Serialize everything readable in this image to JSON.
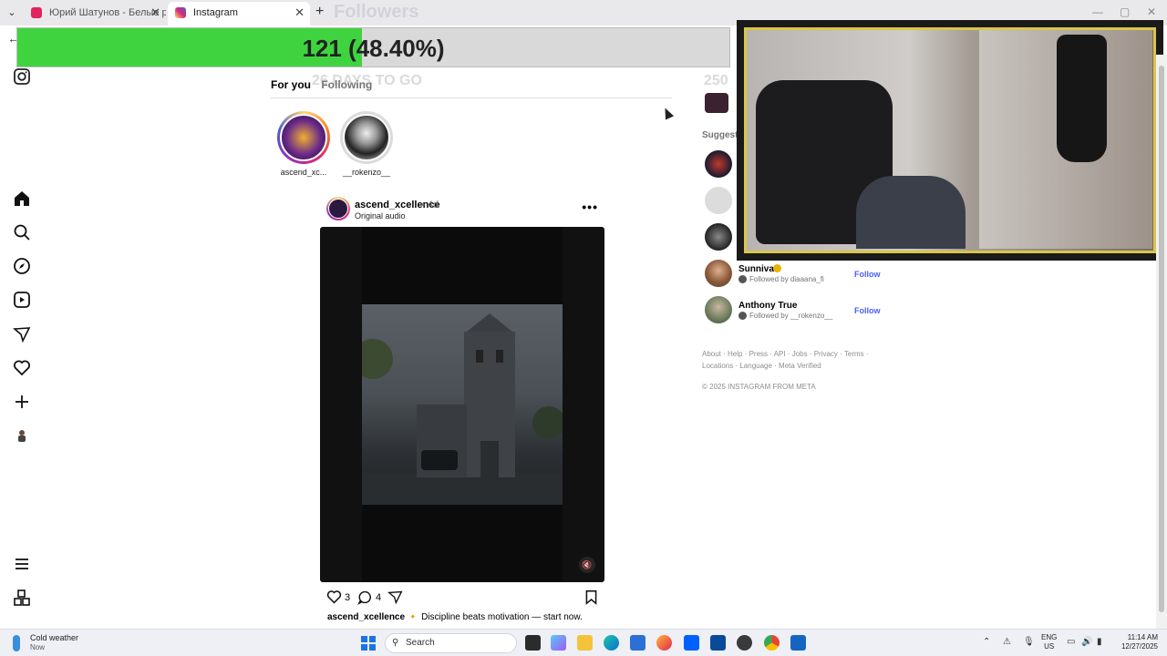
{
  "browser": {
    "tabs": [
      {
        "title": "Юрий Шатунов - Белые розы",
        "active": false,
        "favicon_color": "#e0245e"
      },
      {
        "title": "Instagram",
        "active": true,
        "favicon_color": "#d62976"
      }
    ],
    "new_tab": "+",
    "tab_close": "✕",
    "window_controls": {
      "minimize": "—",
      "maximize": "▢",
      "close": "✕"
    }
  },
  "overlay": {
    "title": "Followers",
    "progress_text": "121 (48.40%)",
    "progress_fraction": 0.484,
    "days_to_go": "26 DAYS TO GO",
    "goal": "250",
    "progress_color": "#3fd43f"
  },
  "nav": {
    "back": "←",
    "items": [
      "instagram-logo-icon",
      "home-icon",
      "search-icon",
      "explore-icon",
      "reels-icon",
      "messages-icon",
      "notifications-icon",
      "create-icon",
      "profile-icon",
      "more-menu-icon",
      "also-from-meta-icon"
    ]
  },
  "feed": {
    "tabs": [
      {
        "label": "For you",
        "active": true
      },
      {
        "label": "Following",
        "active": false
      }
    ],
    "stories": [
      {
        "name": "ascend_xc...",
        "seen": false
      },
      {
        "name": "__rokenzo__",
        "seen": true
      }
    ],
    "post": {
      "user": "ascend_xcellence",
      "time": "• 4d",
      "audio": "Original audio",
      "more": "•••",
      "likes": "3",
      "comments": "4",
      "caption_user": "ascend_xcellence",
      "caption_text": "🔸 Discipline beats motivation — start now.",
      "mute": "🔇"
    }
  },
  "sidebar": {
    "suggested_title": "Suggested",
    "suggestions": [
      {
        "name": "Sunniva",
        "verified": true,
        "followed_by": "Followed by diaaana_fi",
        "action": "Follow"
      },
      {
        "name": "Anthony True",
        "verified": false,
        "followed_by": "Followed by __rokenzo__",
        "action": "Follow"
      }
    ],
    "footer_links": "About · Help · Press · API · Jobs · Privacy · Terms · Locations · Language · Meta Verified",
    "copyright": "© 2025 INSTAGRAM FROM META"
  },
  "taskbar": {
    "weather_title": "Cold weather",
    "weather_sub": "Now",
    "search_placeholder": "Search",
    "lang_line1": "ENG",
    "lang_line2": "US",
    "time": "11:14 AM",
    "date": "12/27/2025"
  }
}
